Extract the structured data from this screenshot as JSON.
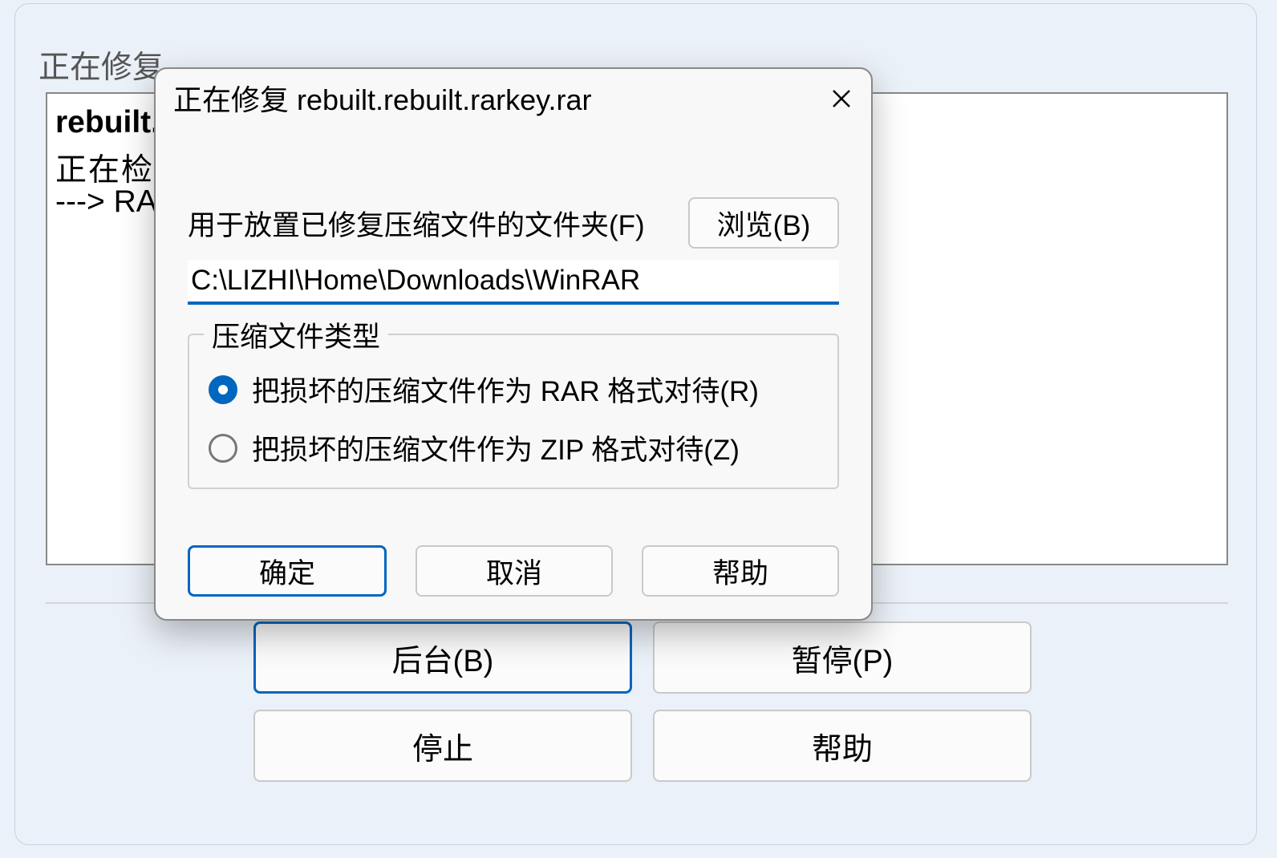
{
  "bg": {
    "window_title": "正在修复",
    "content_line1": "rebuilt.re",
    "content_line2": "正在检测",
    "content_line3": "---> RAR",
    "buttons": {
      "background": "后台(B)",
      "pause": "暂停(P)",
      "stop": "停止",
      "help": "帮助"
    }
  },
  "fg": {
    "title": "正在修复 rebuilt.rebuilt.rarkey.rar",
    "folder_label": "用于放置已修复压缩文件的文件夹(F)",
    "browse_label": "浏览(B)",
    "path_value": "C:\\LIZHI\\Home\\Downloads\\WinRAR",
    "fieldset_legend": "压缩文件类型",
    "radio_rar": "把损坏的压缩文件作为 RAR 格式对待(R)",
    "radio_zip": "把损坏的压缩文件作为 ZIP 格式对待(Z)",
    "ok": "确定",
    "cancel": "取消",
    "help": "帮助"
  }
}
